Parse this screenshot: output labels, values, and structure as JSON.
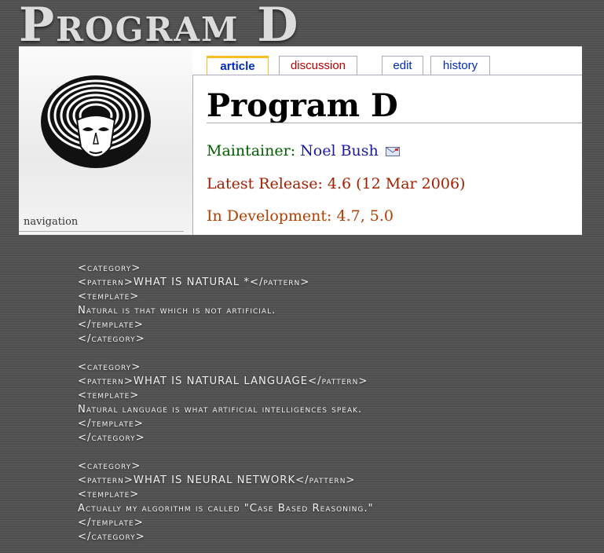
{
  "slide": {
    "title": "Program D"
  },
  "wiki": {
    "nav_label": "navigation",
    "tabs": [
      {
        "label": "article"
      },
      {
        "label": "discussion"
      },
      {
        "label": "edit"
      },
      {
        "label": "history"
      }
    ],
    "page_title": "Program D",
    "maintainer_label": "Maintainer:",
    "maintainer_name": "Noel Bush",
    "latest_release": "Latest Release: 4.6 (12 Mar 2006)",
    "in_development": "In Development: 4.7, 5.0"
  },
  "code_blocks": [
    {
      "open": "<category>",
      "pattern_open": "<pattern>",
      "pattern_text": "WHAT IS NATURAL *",
      "pattern_close": "</pattern>",
      "template_open": "<template>",
      "response": "Natural is that which is not artificial.",
      "template_close": "</template>",
      "close": "</category>"
    },
    {
      "open": "<category>",
      "pattern_open": "<pattern>",
      "pattern_text": "WHAT IS NATURAL LANGUAGE",
      "pattern_close": "</pattern>",
      "template_open": "<template>",
      "response": "Natural language is what artificial intelligences speak.",
      "template_close": "</template>",
      "close": "</category>"
    },
    {
      "open": "<category>",
      "pattern_open": "<pattern>",
      "pattern_text": "WHAT IS NEURAL NETWORK",
      "pattern_close": "</pattern>",
      "template_open": "<template>",
      "response": "Actually my algorithm is called \"Case Based Reasoning.\"",
      "template_close": "</template>",
      "close": "</category>"
    }
  ]
}
